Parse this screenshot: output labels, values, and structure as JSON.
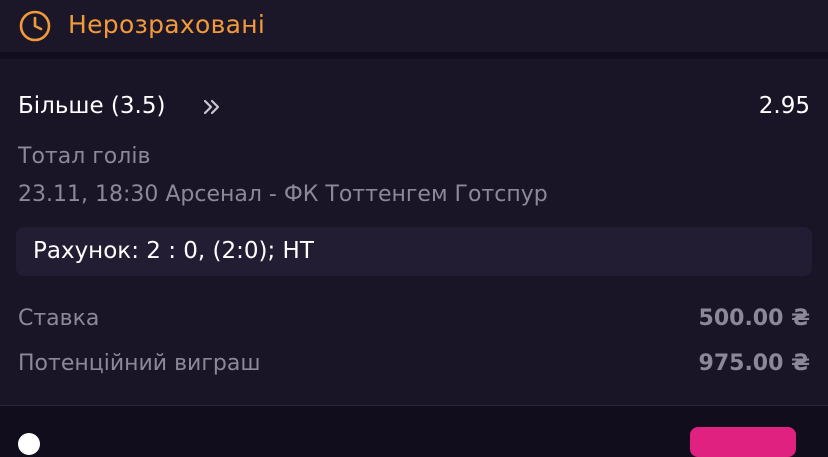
{
  "header": {
    "icon": "clock-icon",
    "title": "Нерозраховані",
    "accent_color": "#f29a3a"
  },
  "bet": {
    "selection": "Більше (3.5)",
    "selection_icon": "double-chevron-right-icon",
    "odds": "2.95",
    "market": "Тотал голів",
    "event": "23.11, 18:30 Арсенал - ФК Тоттенгем Готспур",
    "score": "Рахунок: 2 : 0, (2:0); HT",
    "stake_label": "Ставка",
    "stake_value": "500.00 ₴",
    "potential_win_label": "Потенційний виграш",
    "potential_win_value": "975.00 ₴"
  },
  "footer": {
    "button_color": "#e0217f"
  }
}
